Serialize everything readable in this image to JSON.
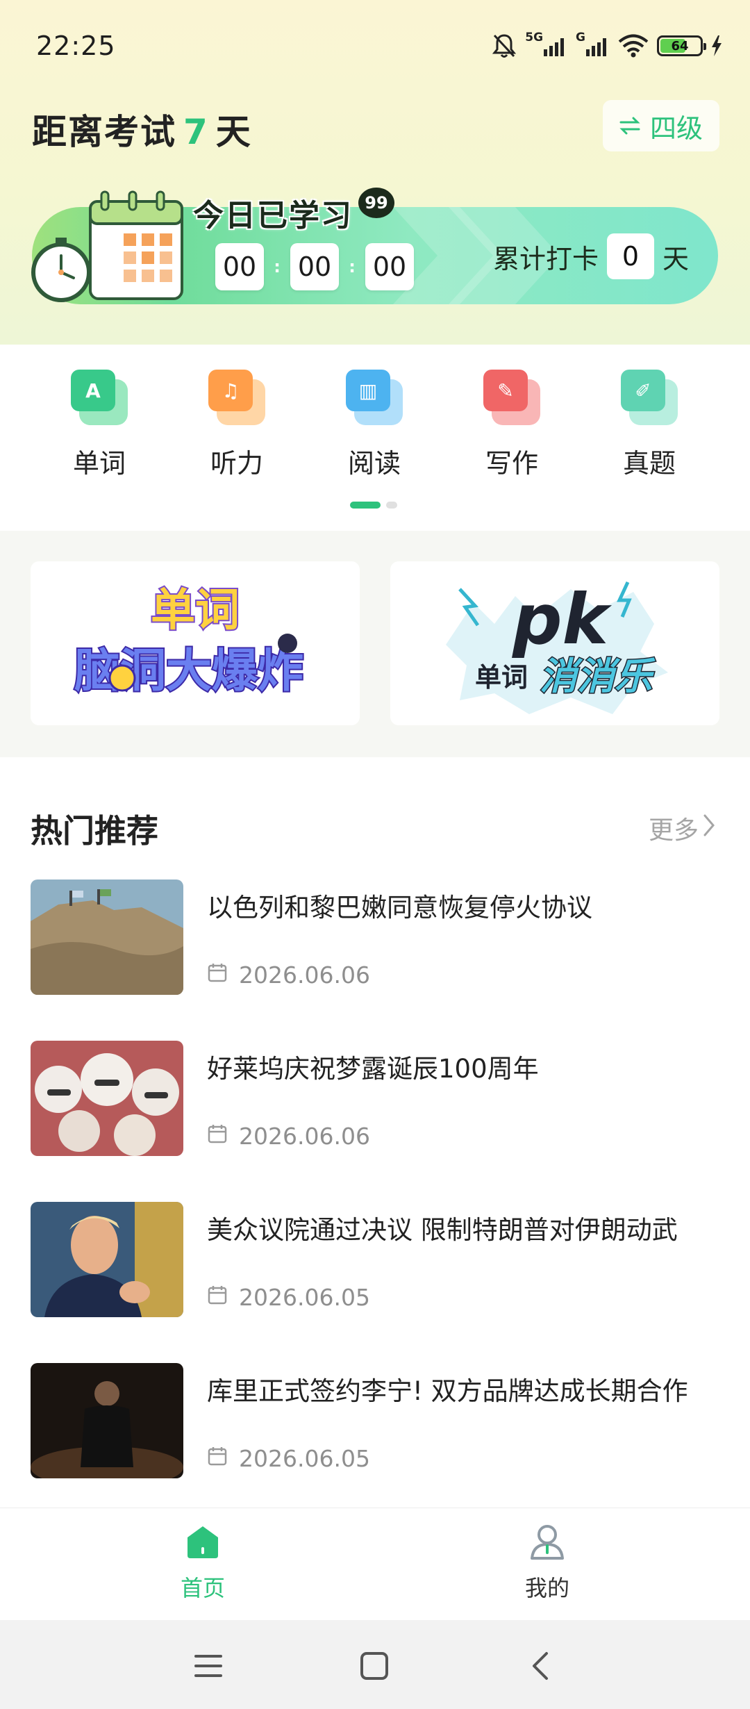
{
  "status_bar": {
    "time": "22:25",
    "network_1": "5G",
    "network_2": "G",
    "battery": "64",
    "battery_level": 0.64
  },
  "header": {
    "exam_prefix": "距离考试",
    "exam_days": "7",
    "exam_suffix": "天",
    "level_label": "四级"
  },
  "study": {
    "title": "今日已学习",
    "badge": "99",
    "hours": "00",
    "minutes": "00",
    "seconds": "00",
    "checkin_label": "累计打卡",
    "checkin_days": "0",
    "checkin_unit": "天"
  },
  "categories": [
    {
      "label": "单词",
      "glyph": "A",
      "color": "#38c98a",
      "back": "#8fe6b8"
    },
    {
      "label": "听力",
      "glyph": "♫",
      "color": "#ff9e4a",
      "back": "#ffd19c"
    },
    {
      "label": "阅读",
      "glyph": "▥",
      "color": "#4db3f0",
      "back": "#a8dcfa"
    },
    {
      "label": "写作",
      "glyph": "✎",
      "color": "#f06666",
      "back": "#f8aeae"
    },
    {
      "label": "真题",
      "glyph": "✐",
      "color": "#5fd3b2",
      "back": "#b0ecdc"
    }
  ],
  "pager": {
    "active": 0,
    "count": 2,
    "active_color": "#2dc27c",
    "inactive_color": "#e0e0e0"
  },
  "games": [
    {
      "line1": "单词",
      "line2": "脑洞大爆炸"
    },
    {
      "line1": "pk",
      "line2a": "单词",
      "line2b": "消消乐"
    }
  ],
  "hot": {
    "title": "热门推荐",
    "more": "更多",
    "items": [
      {
        "title": "以色列和黎巴嫩同意恢复停火协议",
        "date": "2026.06.06"
      },
      {
        "title": "好莱坞庆祝梦露诞辰100周年",
        "date": "2026.06.06"
      },
      {
        "title": "美众议院通过决议 限制特朗普对伊朗动武",
        "date": "2026.06.05"
      },
      {
        "title": "库里正式签约李宁! 双方品牌达成长期合作",
        "date": "2026.06.05"
      }
    ]
  },
  "tabbar": {
    "home": "首页",
    "mine": "我的",
    "active_color": "#2dc27c",
    "inactive_color": "#333333"
  }
}
